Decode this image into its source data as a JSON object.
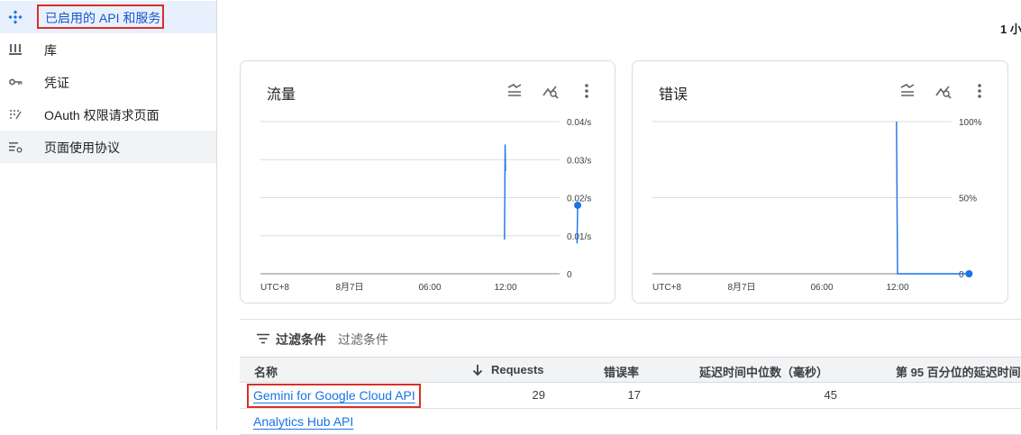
{
  "sidebar": {
    "items": [
      {
        "label": "已启用的 API 和服务",
        "icon": "api-diamond-icon"
      },
      {
        "label": "库",
        "icon": "library-icon"
      },
      {
        "label": "凭证",
        "icon": "key-icon"
      },
      {
        "label": "OAuth 权限请求页面",
        "icon": "oauth-dots-icon"
      },
      {
        "label": "页面使用协议",
        "icon": "settings-list-icon"
      }
    ]
  },
  "header": {
    "time_range": "1 小"
  },
  "traffic_card": {
    "title": "流量",
    "chart_data": {
      "type": "line",
      "x_tick_labels": [
        "UTC+8",
        "8月7日",
        "06:00",
        "12:00"
      ],
      "y_tick_labels": [
        "0.04/s",
        "0.03/s",
        "0.02/s",
        "0.01/s",
        "0"
      ],
      "ylim": [
        0,
        0.04
      ],
      "x": [
        "11:55",
        "11:58",
        "12:00",
        "17:40",
        "17:43"
      ],
      "values": [
        0.009,
        0.034,
        0.027,
        0.008,
        0.018
      ],
      "color": "#1a73e8"
    }
  },
  "errors_card": {
    "title": "错误",
    "chart_data": {
      "type": "line",
      "x_tick_labels": [
        "UTC+8",
        "8月7日",
        "06:00",
        "12:00"
      ],
      "y_tick_labels": [
        "100%",
        "50%",
        "0"
      ],
      "ylim": [
        0,
        100
      ],
      "x": [
        "11:55",
        "12:00",
        "17:40"
      ],
      "values": [
        100,
        0,
        0
      ],
      "color": "#1a73e8"
    }
  },
  "filter": {
    "label": "过滤条件",
    "placeholder": "过滤条件"
  },
  "table": {
    "columns": [
      "名称",
      "Requests",
      "错误率",
      "延迟时间中位数（毫秒）",
      "第 95 百分位的延迟时间"
    ],
    "rows": [
      {
        "name": "Gemini for Google Cloud API",
        "requests": "29",
        "error_rate": "17",
        "latency_median": "45"
      },
      {
        "name": "Analytics Hub API",
        "requests": "",
        "error_rate": "",
        "latency_median": ""
      }
    ]
  },
  "colors": {
    "accent": "#1a73e8",
    "highlight": "#d93025",
    "active_bg": "#e8f0fe"
  }
}
